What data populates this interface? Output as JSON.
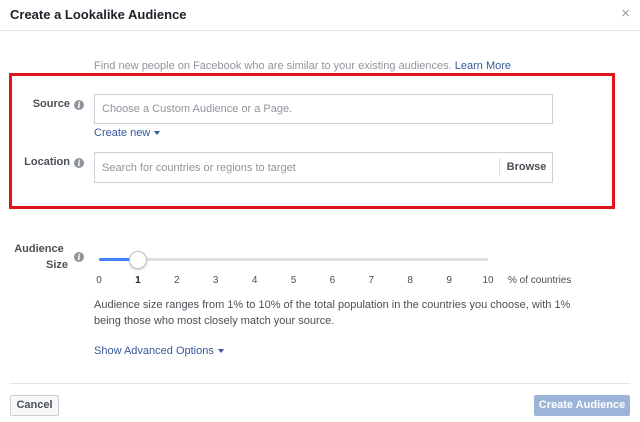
{
  "dialog": {
    "title": "Create a Lookalike Audience",
    "close_glyph": "×"
  },
  "intro": {
    "text": "Find new people on Facebook who are similar to your existing audiences.",
    "link": "Learn More"
  },
  "source": {
    "label": "Source",
    "placeholder": "Choose a Custom Audience or a Page.",
    "create_new": "Create new"
  },
  "location": {
    "label": "Location",
    "placeholder": "Search for countries or regions to target",
    "browse": "Browse"
  },
  "audience_size": {
    "label_line1": "Audience",
    "label_line2": "Size",
    "selected": 1,
    "ticks": [
      "0",
      "1",
      "2",
      "3",
      "4",
      "5",
      "6",
      "7",
      "8",
      "9",
      "10"
    ],
    "unit": "% of countries",
    "help_text": "Audience size ranges from 1% to 10% of the total population in the countries you choose, with 1% being those who most closely match your source."
  },
  "advanced": {
    "label": "Show Advanced Options"
  },
  "footer": {
    "cancel": "Cancel",
    "create": "Create Audience"
  },
  "colors": {
    "highlight_border": "#e1141e",
    "link": "#365899",
    "slider_fill": "#4080ff",
    "create_button_disabled": "#9cb4d8"
  },
  "icons": {
    "info": "info-icon",
    "close": "close-icon",
    "caret": "caret-down-icon"
  }
}
